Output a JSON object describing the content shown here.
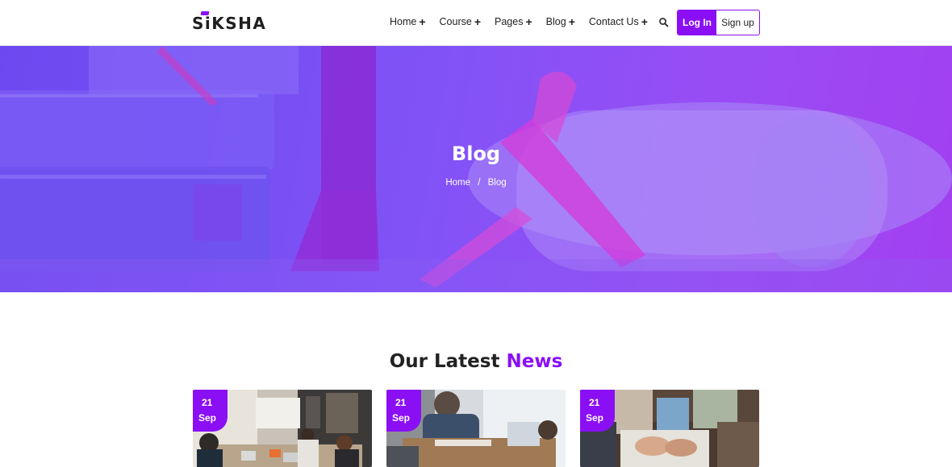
{
  "header": {
    "logo": "SiKSHA",
    "nav": [
      {
        "label": "Home"
      },
      {
        "label": "Course"
      },
      {
        "label": "Pages"
      },
      {
        "label": "Blog"
      },
      {
        "label": "Contact Us"
      }
    ],
    "nav_plus": "+",
    "login_label": "Log In",
    "signup_label": "Sign up"
  },
  "hero": {
    "title": "Blog",
    "breadcrumb": {
      "home": "Home",
      "separator": "/",
      "current": "Blog"
    }
  },
  "section": {
    "title_main": "Our Latest",
    "title_accent": "News"
  },
  "cards": [
    {
      "day": "21",
      "month": "Sep",
      "image": "office-meeting-photo"
    },
    {
      "day": "21",
      "month": "Sep",
      "image": "business-discussion-photo"
    },
    {
      "day": "21",
      "month": "Sep",
      "image": "team-hands-photo"
    }
  ],
  "colors": {
    "accent": "#8a0ff5",
    "hero_start": "#6b49f0",
    "hero_end": "#a23ff0"
  }
}
